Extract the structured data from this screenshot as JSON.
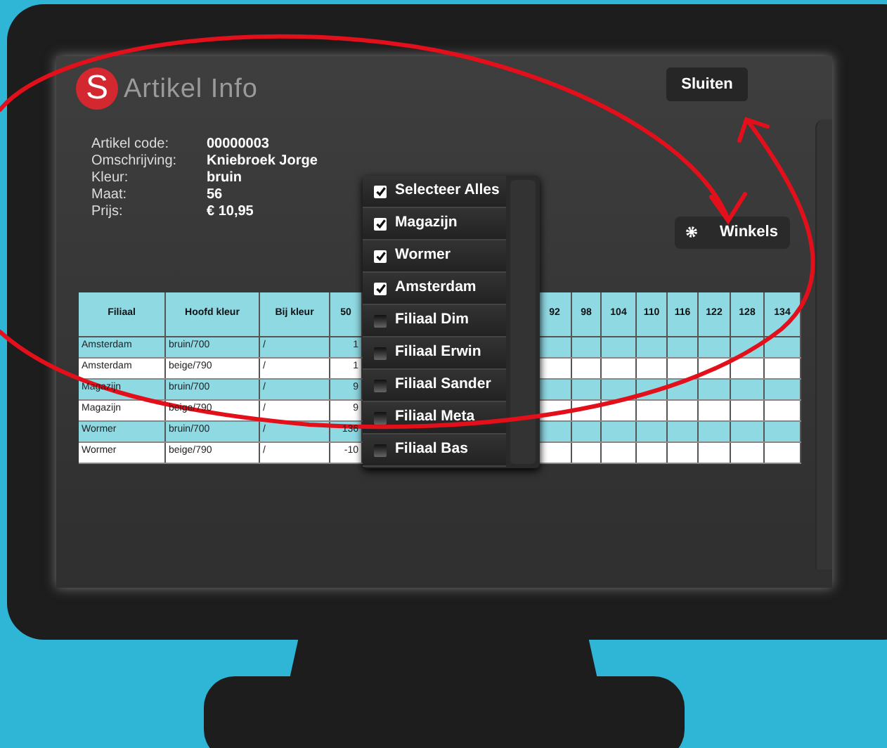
{
  "window": {
    "logo": "S",
    "title": "Artikel Info",
    "close_button": "Sluiten"
  },
  "details": [
    {
      "label": "Artikel code:",
      "value": "00000003"
    },
    {
      "label": "Omschrijving:",
      "value": "Kniebroek Jorge"
    },
    {
      "label": "Kleur:",
      "value": "bruin"
    },
    {
      "label": "Maat:",
      "value": "56"
    },
    {
      "label": "Prijs:",
      "value": "€ 10,95"
    }
  ],
  "stores_button": "Winkels",
  "store_menu": [
    {
      "label": "Selecteer Alles",
      "checked": true
    },
    {
      "label": "Magazijn",
      "checked": true
    },
    {
      "label": "Wormer",
      "checked": true
    },
    {
      "label": "Amsterdam",
      "checked": true
    },
    {
      "label": "Filiaal Dim",
      "checked": false
    },
    {
      "label": "Filiaal Erwin",
      "checked": false
    },
    {
      "label": "Filiaal Sander",
      "checked": false
    },
    {
      "label": "Filiaal Meta",
      "checked": false
    },
    {
      "label": "Filiaal Bas",
      "checked": false
    }
  ],
  "table": {
    "columns": [
      "Filiaal",
      "Hoofd kleur",
      "Bij kleur",
      "50"
    ],
    "size_columns": [
      "92",
      "98",
      "104",
      "110",
      "116",
      "122",
      "128",
      "134"
    ],
    "rows": [
      [
        "Amsterdam",
        "bruin/700",
        "/",
        "1"
      ],
      [
        "Amsterdam",
        "beige/790",
        "/",
        "1"
      ],
      [
        "Magazijn",
        "bruin/700",
        "/",
        "9"
      ],
      [
        "Magazijn",
        "beige/790",
        "/",
        "9"
      ],
      [
        "Wormer",
        "bruin/700",
        "/",
        "136"
      ],
      [
        "Wormer",
        "beige/790",
        "/",
        "-10"
      ]
    ]
  }
}
